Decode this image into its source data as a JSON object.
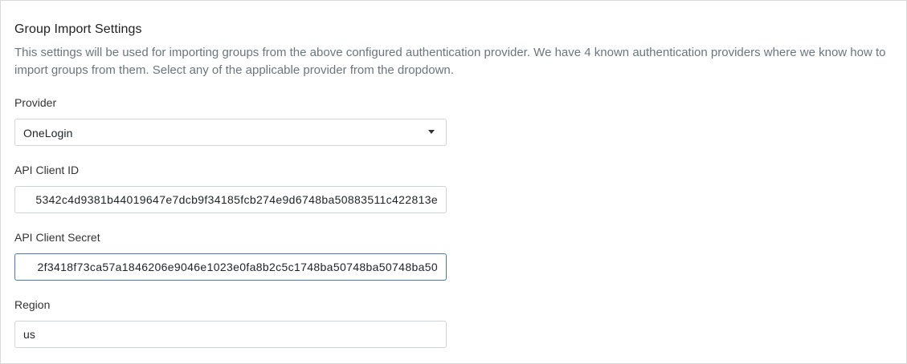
{
  "section": {
    "title": "Group Import Settings",
    "description": "This settings will be used for importing groups from the above configured authentication provider. We have 4 known authentication providers where we know how to import groups from them. Select any of the applicable provider from the dropdown."
  },
  "provider": {
    "label": "Provider",
    "selected": "OneLogin"
  },
  "client_id": {
    "label": "API Client ID",
    "value": "5342c4d9381b44019647e7dcb9f34185fcb274e9d6748ba50883511c422813e"
  },
  "client_secret": {
    "label": "API Client Secret",
    "value": "2f3418f73ca57a1846206e9046e1023e0fa8b2c5c1748ba50748ba50748ba50"
  },
  "region": {
    "label": "Region",
    "value": "us"
  },
  "icons": {
    "dropdown": "caret-down-icon"
  }
}
